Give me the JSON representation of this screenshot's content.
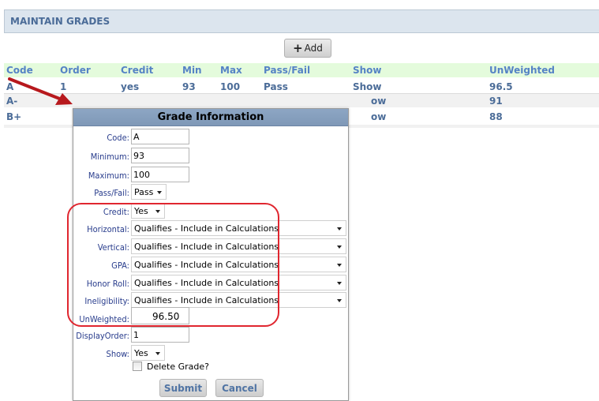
{
  "header": {
    "title": "MAINTAIN GRADES",
    "add_label": "Add",
    "add_icon": "plus-icon"
  },
  "grid": {
    "columns": [
      "Code",
      "Order",
      "Credit",
      "Min",
      "Max",
      "Pass/Fail",
      "Show",
      "UnWeighted"
    ],
    "rows": [
      [
        "A",
        "1",
        "yes",
        "93",
        "100",
        "Pass",
        "Show",
        "96.5"
      ],
      [
        "A-",
        "",
        "",
        "",
        "",
        "",
        "ow",
        "91"
      ],
      [
        "B+",
        "",
        "",
        "",
        "",
        "",
        "ow",
        "88"
      ]
    ]
  },
  "dialog": {
    "title": "Grade Information",
    "fields": {
      "code": {
        "label": "Code:",
        "value": "A"
      },
      "minimum": {
        "label": "Minimum:",
        "value": "93"
      },
      "maximum": {
        "label": "Maximum:",
        "value": "100"
      },
      "pass_fail": {
        "label": "Pass/Fail:",
        "value": "Pass"
      },
      "credit": {
        "label": "Credit:",
        "value": "Yes"
      },
      "horizontal": {
        "label": "Horizontal:",
        "value": "Qualifies - Include in Calculations"
      },
      "vertical": {
        "label": "Vertical:",
        "value": "Qualifies - Include in Calculations"
      },
      "gpa": {
        "label": "GPA:",
        "value": "Qualifies - Include in Calculations"
      },
      "honor_roll": {
        "label": "Honor Roll:",
        "value": "Qualifies - Include in Calculations"
      },
      "ineligibility": {
        "label": "Ineligibility:",
        "value": "Qualifies - Include in Calculations"
      },
      "unweighted": {
        "label": "UnWeighted:",
        "value": "96.50"
      },
      "display_order": {
        "label": "DisplayOrder:",
        "value": "1"
      },
      "show": {
        "label": "Show:",
        "value": "Yes"
      }
    },
    "delete_label": "Delete Grade?",
    "delete_checked": false,
    "submit_label": "Submit",
    "cancel_label": "Cancel"
  },
  "colors": {
    "annotation": "#e0262f",
    "label": "#283c8c",
    "grid_text": "#4b6c98",
    "header_band": "#e4fbdc"
  }
}
